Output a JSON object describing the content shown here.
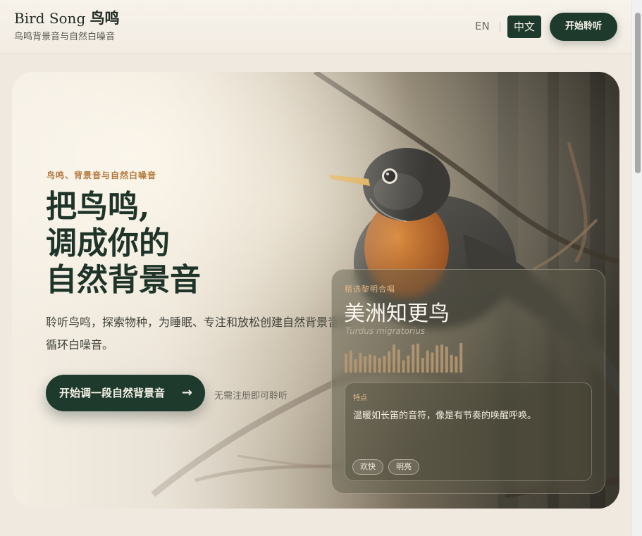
{
  "header": {
    "brand_name": "Bird Song",
    "brand_name_cn": "鸟鸣",
    "brand_subtitle": "鸟鸣背景音与自然白噪音",
    "lang_en": "EN",
    "lang_cn": "中文",
    "start_button": "开始聆听"
  },
  "hero": {
    "eyebrow": "鸟鸣、背景音与自然白噪音",
    "title_lines": [
      "把鸟鸣,",
      "调成你的",
      "自然背景音"
    ],
    "description": "聆听鸟鸣，探索物种，为睡眠、专注和放松创建自然背景音与循环白噪音。",
    "cta_label": "开始调一段自然背景音",
    "cta_arrow": "→",
    "note": "无需注册即可聆听"
  },
  "featured": {
    "eyebrow": "精选黎明合唱",
    "name": "美洲知更鸟",
    "latin": "Turdus migratorius",
    "trait_label": "特点",
    "trait_text": "温暖如长笛的音符，像是有节奏的唤醒呼唤。",
    "tags": [
      "欢快",
      "明亮"
    ],
    "waveform_levels": [
      0.65,
      0.75,
      0.45,
      0.67,
      0.55,
      0.62,
      0.58,
      0.5,
      0.57,
      0.72,
      0.95,
      0.78,
      0.42,
      0.58,
      0.95,
      0.98,
      0.5,
      0.75,
      0.68,
      0.92,
      0.95,
      0.88,
      0.6,
      0.55,
      1.0
    ]
  },
  "colors": {
    "accent_dark_green": "#1d3a2c",
    "accent_amber": "#b57a3e",
    "wave_color": "#b99a73"
  }
}
